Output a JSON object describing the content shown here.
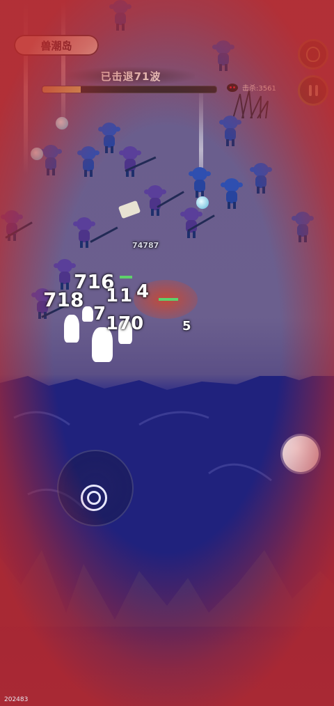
{
  "hud": {
    "location": "兽潮岛",
    "wave_text": "已击退71波",
    "wave_progress": 0.22,
    "kill_label": "击杀:3561",
    "potion_icon": "potion-icon",
    "pause_icon": "pause-icon"
  },
  "combat": {
    "damage_numbers": [
      "716",
      "4",
      "718",
      "1",
      "1",
      "7",
      "170",
      "5"
    ],
    "small_damage": "74787"
  },
  "controls": {
    "joystick_icon": "joystick-icon",
    "skill_icon": "skill-button-icon"
  },
  "footer": {
    "build_id": "202483"
  },
  "colors": {
    "accent_bar": "#d8c36a",
    "enemy_blue": "#2f4fb0",
    "enemy_purple": "#5a3f9a",
    "hp_green": "#5fd16b",
    "danger_vignette": "#be2828"
  }
}
